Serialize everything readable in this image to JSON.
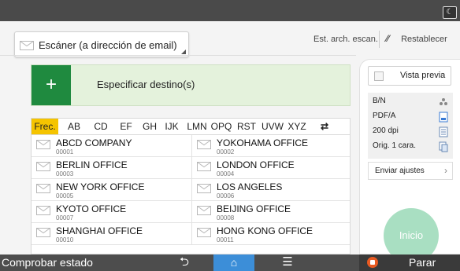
{
  "header": {
    "moon_icon": "moon-icon"
  },
  "scanner": {
    "label": "Escáner (a dirección de email)"
  },
  "links": {
    "est_arch": "Est. arch. escan.",
    "restablecer": "Restablecer"
  },
  "destination": {
    "plus": "+",
    "label": "Especificar destino(s)"
  },
  "tabs": [
    {
      "label": "Frec."
    },
    {
      "label": "AB"
    },
    {
      "label": "CD"
    },
    {
      "label": "EF"
    },
    {
      "label": "GH"
    },
    {
      "label": "IJK"
    },
    {
      "label": "LMN"
    },
    {
      "label": "OPQ"
    },
    {
      "label": "RST"
    },
    {
      "label": "UVW"
    },
    {
      "label": "XYZ"
    }
  ],
  "entries": [
    {
      "name": "ABCD COMPANY",
      "num": "00001"
    },
    {
      "name": "YOKOHAMA OFFICE",
      "num": "00002"
    },
    {
      "name": "BERLIN OFFICE",
      "num": "00003"
    },
    {
      "name": "LONDON OFFICE",
      "num": "00004"
    },
    {
      "name": "NEW YORK OFFICE",
      "num": "00005"
    },
    {
      "name": "LOS ANGELES",
      "num": "00006"
    },
    {
      "name": "KYOTO OFFICE",
      "num": "00007"
    },
    {
      "name": "BEIJING OFFICE",
      "num": "00008"
    },
    {
      "name": "SHANGHAI  OFFICE",
      "num": "00010"
    },
    {
      "name": "HONG KONG OFFICE",
      "num": "00011"
    }
  ],
  "panel": {
    "preview": "Vista previa",
    "settings": [
      {
        "label": "B/N",
        "icon": "color-dots-icon"
      },
      {
        "label": "PDF/A",
        "icon": "file-type-icon"
      },
      {
        "label": "200 dpi",
        "icon": "resolution-icon"
      },
      {
        "label": "Orig. 1 cara.",
        "icon": "single-side-icon"
      }
    ],
    "send_settings": "Enviar ajustes",
    "start": "Inicio"
  },
  "bottom": {
    "status": "Comprobar estado",
    "stop": "Parar",
    "accent_home": "#3c8ed8",
    "accent_stop": "#e85a22"
  },
  "colors": {
    "green_button": "#1f8a3f",
    "active_tab": "#f5c400",
    "start_button": "#a9dfc2"
  }
}
